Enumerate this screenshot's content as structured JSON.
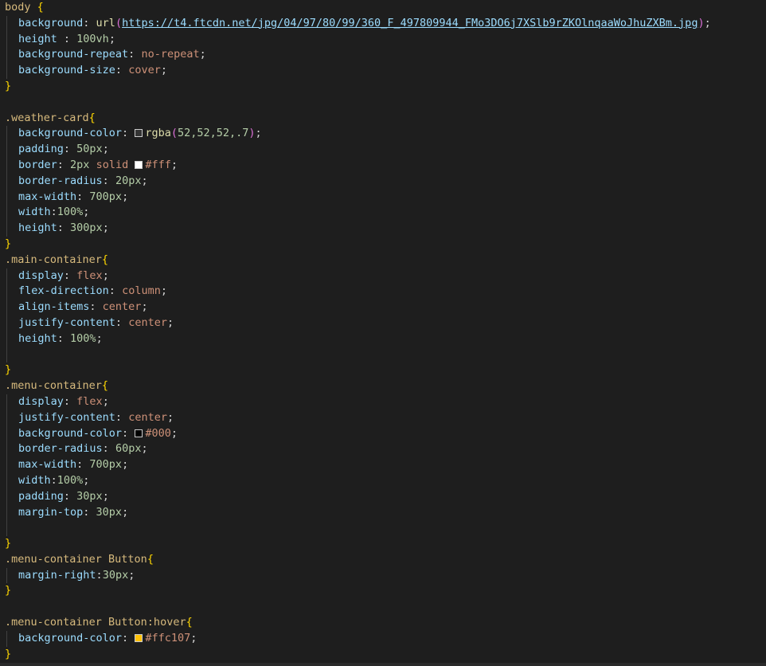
{
  "editor": {
    "language": "css",
    "swatch_colors": {
      "weather_bg": "#343434",
      "border_white": "#ffffff",
      "menu_black": "#000000",
      "hover_amber": "#ffc107"
    },
    "lines": {
      "body_sel": "body",
      "l1_prop": "background",
      "l1_func": "url",
      "l1_url": "https://t4.ftcdn.net/jpg/04/97/80/99/360_F_497809944_FMo3DO6j7XSlb9rZKOlnqaaWoJhuZXBm.jpg",
      "l2_prop": "height",
      "l2_val": "100vh",
      "l3_prop": "background-repeat",
      "l3_val": "no-repeat",
      "l4_prop": "background-size",
      "l4_val": "cover",
      "wc_sel": ".weather-card",
      "wc1_prop": "background-color",
      "wc1_func": "rgba",
      "wc1_args": "52,52,52,.7",
      "wc2_prop": "padding",
      "wc2_val": "50px",
      "wc3_prop": "border",
      "wc3_num": "2px",
      "wc3_kw": "solid",
      "wc3_color": "#fff",
      "wc4_prop": "border-radius",
      "wc4_val": "20px",
      "wc5_prop": "max-width",
      "wc5_val": "700px",
      "wc6_prop": "width",
      "wc6_val": "100%",
      "wc7_prop": "height",
      "wc7_val": "300px",
      "mc_sel": ".main-container",
      "mc1_prop": "display",
      "mc1_val": "flex",
      "mc2_prop": "flex-direction",
      "mc2_val": "column",
      "mc3_prop": "align-items",
      "mc3_val": "center",
      "mc4_prop": "justify-content",
      "mc4_val": "center",
      "mc5_prop": "height",
      "mc5_val": "100%",
      "mn_sel": ".menu-container",
      "mn1_prop": "display",
      "mn1_val": "flex",
      "mn2_prop": "justify-content",
      "mn2_val": "center",
      "mn3_prop": "background-color",
      "mn3_color": "#000",
      "mn4_prop": "border-radius",
      "mn4_val": "60px",
      "mn5_prop": "max-width",
      "mn5_val": "700px",
      "mn6_prop": "width",
      "mn6_val": "100%",
      "mn7_prop": "padding",
      "mn7_val": "30px",
      "mn8_prop": "margin-top",
      "mn8_val": "30px",
      "mb_sel": ".menu-container Button",
      "mb1_prop": "margin-right",
      "mb1_val": "30px",
      "mh_sel": ".menu-container Button:hover",
      "mh1_prop": "background-color",
      "mh1_color": "#ffc107"
    }
  }
}
